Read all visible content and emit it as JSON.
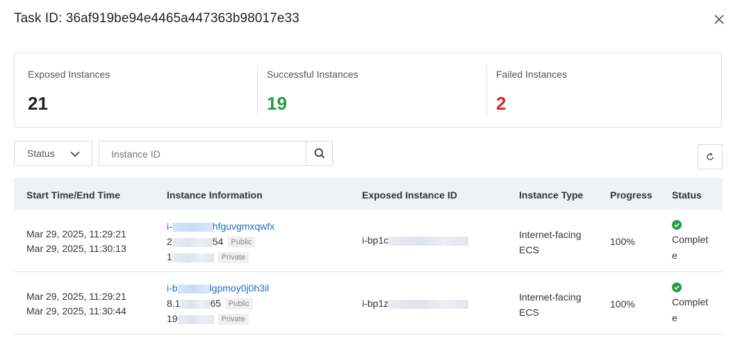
{
  "dialog": {
    "title": "Task ID: 36af919be94e4465a447363b98017e33"
  },
  "summary": {
    "exposed_label": "Exposed Instances",
    "exposed_value": "21",
    "success_label": "Successful Instances",
    "success_value": "19",
    "failed_label": "Failed Instances",
    "failed_value": "2"
  },
  "filters": {
    "status_label": "Status",
    "search_placeholder": "Instance ID"
  },
  "table": {
    "columns": [
      "Start Time/End Time",
      "Instance Information",
      "Exposed Instance ID",
      "Instance Type",
      "Progress",
      "Status"
    ],
    "rows": [
      {
        "start": "Mar 29, 2025, 11:29:21",
        "end": "Mar 29, 2025, 11:30:13",
        "id_prefix": "i-",
        "id_suffix": "hfguvgmxqwfx",
        "public_prefix": "2",
        "public_suffix": "54",
        "public_tag": "Public",
        "private_prefix": "1",
        "private_tag": "Private",
        "exposed_prefix": "i-bp1c",
        "type_line1": "Internet-facing",
        "type_line2": "ECS",
        "progress": "100%",
        "status_line1": "Complet",
        "status_line2": "e"
      },
      {
        "start": "Mar 29, 2025, 11:29:21",
        "end": "Mar 29, 2025, 11:30:44",
        "id_prefix": "i-b",
        "id_suffix": "lgpmoy0j0h3il",
        "public_prefix": "8.1",
        "public_suffix": "65",
        "public_tag": "Public",
        "private_prefix": "19",
        "private_tag": "Private",
        "exposed_prefix": "i-bp1z",
        "type_line1": "Internet-facing",
        "type_line2": "ECS",
        "progress": "100%",
        "status_line1": "Complet",
        "status_line2": "e"
      }
    ]
  },
  "colors": {
    "success": "#269a44",
    "failed": "#d9262b",
    "link": "#1a6ec2",
    "header_bg": "#eef1f6"
  },
  "icons": {
    "close": "close-icon",
    "chevron": "chevron-down-icon",
    "search": "search-icon",
    "refresh": "refresh-icon",
    "status_ok": "check-circle-icon"
  }
}
